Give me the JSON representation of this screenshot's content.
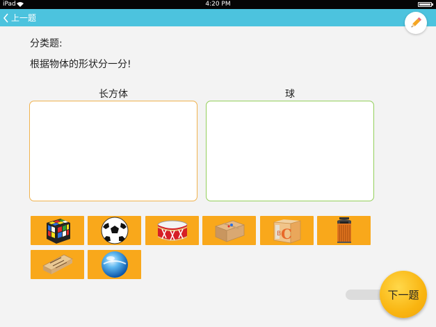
{
  "status_bar": {
    "carrier": "iPad",
    "time": "4:20 PM"
  },
  "nav": {
    "back_label": "上一题"
  },
  "question": {
    "type_label": "分类题:",
    "prompt": "根据物体的形状分一分!"
  },
  "categories": [
    {
      "label": "长方体",
      "color": "#f0b24e"
    },
    {
      "label": "球",
      "color": "#93cf5a"
    }
  ],
  "items": [
    {
      "icon": "rubiks-cube-icon"
    },
    {
      "icon": "soccer-ball-icon"
    },
    {
      "icon": "drum-icon"
    },
    {
      "icon": "cardboard-box-icon"
    },
    {
      "icon": "letter-block-icon"
    },
    {
      "icon": "trash-bin-icon"
    },
    {
      "icon": "eraser-icon"
    },
    {
      "icon": "glass-ball-icon"
    }
  ],
  "tile_color": "#f9a81b",
  "next_button": {
    "label": "下一题"
  }
}
